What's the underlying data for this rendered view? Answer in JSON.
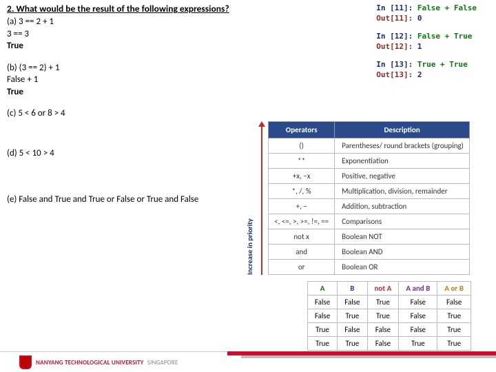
{
  "question": {
    "title": "2. What would be the result of the following expressions?",
    "a": {
      "label": "(a)  3 == 2 + 1",
      "l2": "3 == 3",
      "l3": "True"
    },
    "b": {
      "label": "(b) (3 == 2) + 1",
      "l2": "False + 1",
      "l3": "True"
    },
    "c": {
      "label": "(c) 5 < 6 or 8 > 4"
    },
    "d": {
      "label": "(d) 5 < 10 > 4"
    },
    "e": {
      "label": "(e) False and True and True or False or True and False"
    }
  },
  "console": {
    "g1": {
      "in_label": "In [11]:",
      "in_code": " False + False",
      "out_label": "Out[11]:",
      "out_val": " 0"
    },
    "g2": {
      "in_label": "In [12]:",
      "in_code": " False + True",
      "out_label": "Out[12]:",
      "out_val": " 1"
    },
    "g3": {
      "in_label": "In [13]:",
      "in_code": " True + True",
      "out_label": "Out[13]:",
      "out_val": " 2"
    }
  },
  "op_table": {
    "arrow_label": "Increase in priority",
    "h1": "Operators",
    "h2": "Description",
    "rows": [
      {
        "op": "()",
        "desc": "Parentheses/ round brackets (grouping)"
      },
      {
        "op": "**",
        "desc": "Exponentiation"
      },
      {
        "op": "+x, −x",
        "desc": "Positive, negative"
      },
      {
        "op": "*, /, %",
        "desc": "Multiplication, division, remainder"
      },
      {
        "op": "+, −",
        "desc": "Addition, subtraction"
      },
      {
        "op": "<, <=, >, >=, !=, ==",
        "desc": "Comparisons"
      },
      {
        "op": "not x",
        "desc": "Boolean NOT"
      },
      {
        "op": "and",
        "desc": "Boolean AND"
      },
      {
        "op": "or",
        "desc": "Boolean OR"
      }
    ]
  },
  "truth": {
    "hA": "A",
    "hB": "B",
    "hNot": "not A",
    "hAnd": "A and B",
    "hOr": "A or B",
    "rows": [
      {
        "a": "False",
        "b": "False",
        "not": "True",
        "and": "False",
        "or": "False"
      },
      {
        "a": "False",
        "b": "True",
        "not": "True",
        "and": "False",
        "or": "True"
      },
      {
        "a": "True",
        "b": "False",
        "not": "False",
        "and": "False",
        "or": "True"
      },
      {
        "a": "True",
        "b": "True",
        "not": "False",
        "and": "True",
        "or": "True"
      }
    ]
  },
  "footer": {
    "uni": "NANYANG TECHNOLOGICAL UNIVERSITY",
    "sg": "SINGAPORE"
  }
}
